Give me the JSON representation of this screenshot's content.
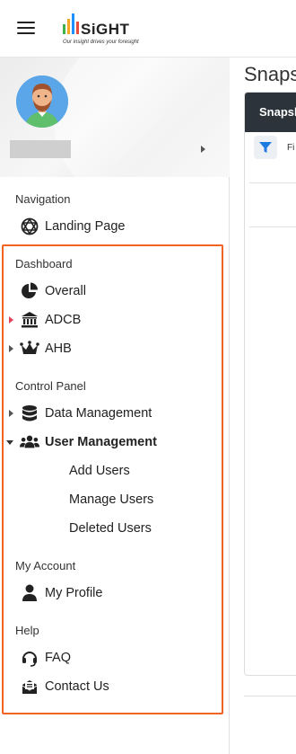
{
  "header": {
    "logo_text": "SiGHT",
    "logo_tagline": "Our insight drives your foresight"
  },
  "sidebar": {
    "profile": {
      "avatar": "avatar-icon",
      "name": ""
    },
    "sections": {
      "navigation": {
        "title": "Navigation",
        "items": [
          {
            "label": "Landing Page",
            "icon": "atom-icon"
          }
        ]
      },
      "dashboard": {
        "title": "Dashboard",
        "items": [
          {
            "label": "Overall",
            "icon": "pie-chart-icon"
          },
          {
            "label": "ADCB",
            "icon": "bank-icon"
          },
          {
            "label": "AHB",
            "icon": "crown-icon"
          }
        ]
      },
      "control_panel": {
        "title": "Control Panel",
        "items": [
          {
            "label": "Data Management",
            "icon": "database-icon"
          },
          {
            "label": "User Management",
            "icon": "users-icon",
            "expanded": true,
            "subitems": [
              {
                "label": "Add Users"
              },
              {
                "label": "Manage Users"
              },
              {
                "label": "Deleted Users"
              }
            ]
          }
        ]
      },
      "my_account": {
        "title": "My Account",
        "items": [
          {
            "label": "My Profile",
            "icon": "user-icon"
          }
        ]
      },
      "help": {
        "title": "Help",
        "items": [
          {
            "label": "FAQ",
            "icon": "headset-icon"
          },
          {
            "label": "Contact Us",
            "icon": "envelope-icon"
          }
        ]
      }
    }
  },
  "main": {
    "page_title": "Snaps",
    "card_header": "Snapsh",
    "filter_label": "Fi"
  },
  "colors": {
    "highlight": "#f26322",
    "card_header_bg": "#2c333a",
    "filter_icon": "#1f7ae0"
  }
}
